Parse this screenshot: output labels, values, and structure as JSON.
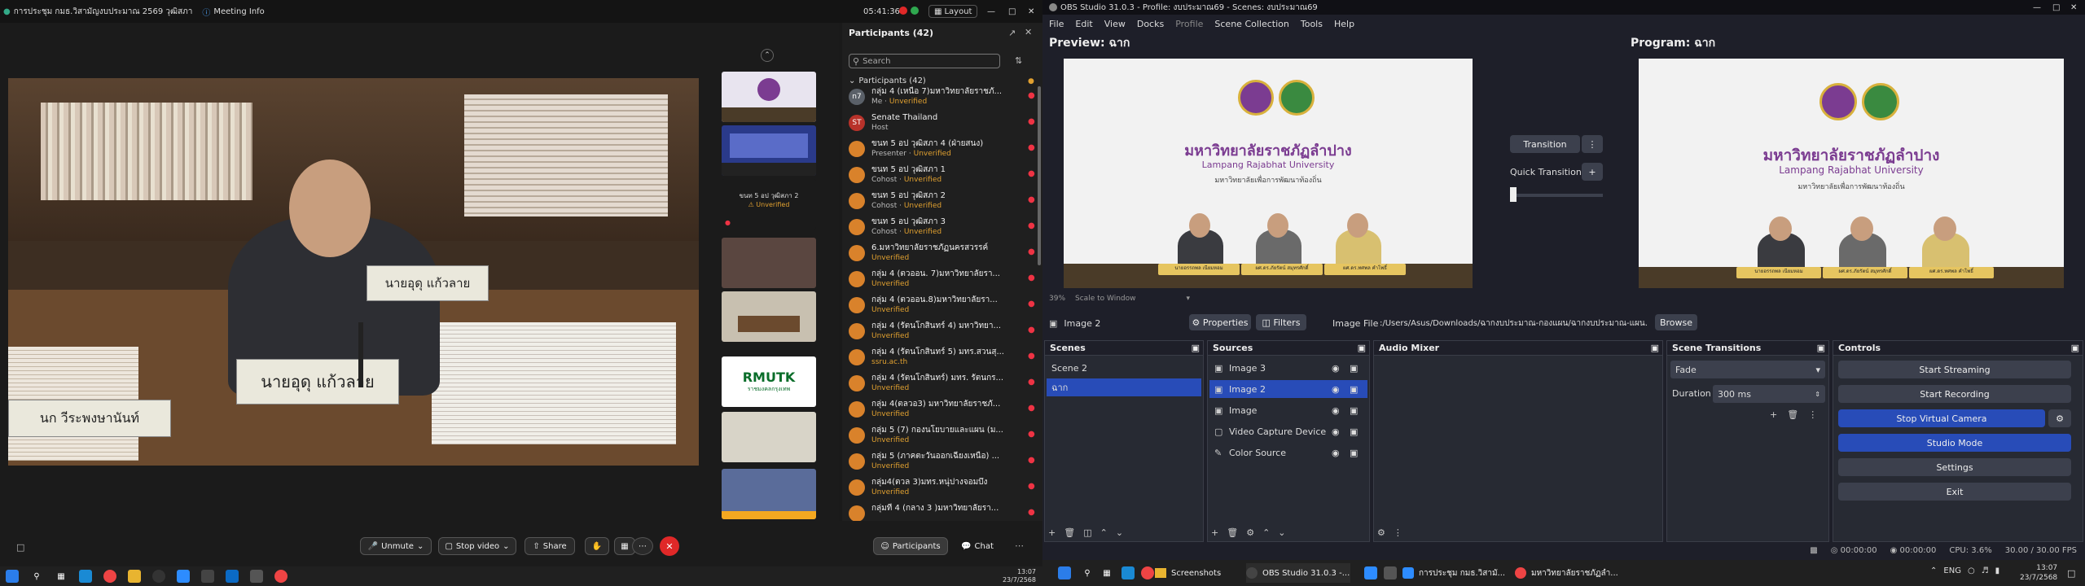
{
  "zoom": {
    "meeting_title": "การประชุม กมธ.วิสามัญงบประมาณ 2569 วุฒิสภา",
    "meeting_info": "Meeting Info",
    "timer": "05:41:36",
    "layout_label": "Layout",
    "nameplate_front": "นายอุดุ แก้วลาย",
    "nameplate_back": "นายอุดุ แก้วลาย",
    "nameplate_left": "นก วีระพงษานันท์",
    "thumb_label": "ขนท 5 อป วุฒิสภา 2",
    "thumb_status": "Unverified",
    "thumb_brand": "RMUTK",
    "thumb_brand_sub": "ราชมงคลกรุงเทพ",
    "toolbar": {
      "unmute": "Unmute",
      "stop_video": "Stop video",
      "share": "Share",
      "participants": "Participants",
      "chat": "Chat"
    },
    "panel_title": "Participants (42)",
    "search_placeholder": "Search",
    "group_title": "Participants (42)",
    "participants": [
      {
        "avatar": "n7",
        "name": "กลุ่ม 4 (เหนือ 7)มหาวิทยาลัยราชภั...",
        "role": "Me",
        "status": "Unverified"
      },
      {
        "avatar": "ST",
        "name": "Senate Thailand",
        "role": "Host",
        "status": ""
      },
      {
        "avatar": "",
        "name": "ขนท 5 อป วุฒิสภา 4 (ฝ่ายสนง)",
        "role": "Presenter",
        "status": "Unverified"
      },
      {
        "avatar": "",
        "name": "ขนท 5 อป วุฒิสภา 1",
        "role": "Cohost",
        "status": "Unverified"
      },
      {
        "avatar": "",
        "name": "ขนท 5 อป วุฒิสภา 2",
        "role": "Cohost",
        "status": "Unverified"
      },
      {
        "avatar": "",
        "name": "ขนท 5 อป วุฒิสภา 3",
        "role": "Cohost",
        "status": "Unverified"
      },
      {
        "avatar": "",
        "name": "6.มหาวิทยาลัยราชภัฏนครสวรรค์",
        "role": "",
        "status": "Unverified"
      },
      {
        "avatar": "",
        "name": "กลุ่ม 4 (ตวออน. 7)มหาวิทยาลัยรา...",
        "role": "",
        "status": "Unverified"
      },
      {
        "avatar": "",
        "name": "กลุ่ม 4 (ตวออน.8)มหาวิทยาลัยรา...",
        "role": "",
        "status": "Unverified"
      },
      {
        "avatar": "",
        "name": "กลุ่ม 4 (รัตนโกสินทร์ 4) มหาวิทยา...",
        "role": "",
        "status": "Unverified"
      },
      {
        "avatar": "",
        "name": "กลุ่ม 4 (รัตนโกสินทร์ 5) มทร.สวนสุ...",
        "role": "",
        "status": "ssru.ac.th"
      },
      {
        "avatar": "",
        "name": "กลุ่ม 4 (รัตนโกสินทร์) มทร. รัตนกร...",
        "role": "",
        "status": "Unverified"
      },
      {
        "avatar": "",
        "name": "กลุ่ม 4(ตลวอ3) มหาวิทยาลัยราชภั...",
        "role": "",
        "status": "Unverified"
      },
      {
        "avatar": "",
        "name": "กลุ่ม 5 (7) กองนโยบายและแผน (ม...",
        "role": "",
        "status": "Unverified"
      },
      {
        "avatar": "",
        "name": "กลุ่ม 5 (ภาคตะวันออกเฉียงเหนือ) ...",
        "role": "",
        "status": "Unverified"
      },
      {
        "avatar": "",
        "name": "กลุ่ม4(ตวล 3)มทร.หนุ่ปางจอมบึง",
        "role": "",
        "status": "Unverified"
      },
      {
        "avatar": "",
        "name": "กลุ่มที่ 4 (กลาง 3 )มหาวิทยาลัยรา...",
        "role": "",
        "status": ""
      }
    ],
    "tray_time": "13:07",
    "tray_date": "23/7/2568"
  },
  "obs": {
    "title": "OBS Studio 31.0.3 - Profile: งบประมาณ69 - Scenes: งบประมาณ69",
    "menu": [
      "File",
      "Edit",
      "View",
      "Docks",
      "Profile",
      "Scene Collection",
      "Tools",
      "Help"
    ],
    "preview_label": "Preview: ฉาก",
    "program_label": "Program: ฉาก",
    "uni_th": "มหาวิทยาลัยราชภัฏลำปาง",
    "uni_en": "Lampang Rajabhat University",
    "uni_motto": "มหาวิทยาลัยเพื่อการพัฒนาท้องถิ่น",
    "plates": [
      "นายอรรถพล เนียมหอม",
      "ผศ.ดร.ภัยรัตน์ สมุทรศักดิ์",
      "ผศ.ดร.ทศพล คำโพธิ์"
    ],
    "transition_button": "Transition",
    "quick_transitions": "Quick Transitions",
    "zoom_pct": "39%",
    "scale_mode": "Scale to Window",
    "selected_source": "Image 2",
    "properties": "Properties",
    "filters": "Filters",
    "image_file_label": "Image File",
    "image_file_path": ":/Users/Asus/Downloads/ฉากงบประมาณ-กองแผน/ฉากงบประมาณ-แผน.png",
    "browse": "Browse",
    "panels": {
      "scenes": "Scenes",
      "sources": "Sources",
      "mixer": "Audio Mixer",
      "transitions": "Scene Transitions",
      "controls": "Controls"
    },
    "scenes": [
      "Scene 2",
      "ฉาก"
    ],
    "sources": [
      {
        "name": "Image 3",
        "icon": "image-icon"
      },
      {
        "name": "Image 2",
        "icon": "image-icon"
      },
      {
        "name": "Image",
        "icon": "image-icon"
      },
      {
        "name": "Video Capture Device",
        "icon": "camera-icon"
      },
      {
        "name": "Color Source",
        "icon": "brush-icon"
      }
    ],
    "transition_type": "Fade",
    "duration_label": "Duration",
    "duration_value": "300 ms",
    "controls": [
      "Start Streaming",
      "Start Recording",
      "Stop Virtual Camera",
      "Studio Mode",
      "Settings",
      "Exit"
    ],
    "status": {
      "stream_time": "00:00:00",
      "rec_time": "00:00:00",
      "cpu": "CPU: 3.6%",
      "fps": "30.00 / 30.00 FPS"
    }
  },
  "taskbar2": {
    "apps": [
      {
        "label": "Screenshots"
      },
      {
        "label": "OBS Studio 31.0.3 -..."
      },
      {
        "label": "การประชุม กมธ.วิสามั..."
      },
      {
        "label": "มหาวิทยาลัยราชภัฏลำ..."
      }
    ],
    "lang": "ENG",
    "time": "13:07",
    "date": "23/7/2568"
  },
  "colors": {
    "obs_blue": "#284cb8",
    "zoom_red": "#e02828",
    "unverified": "#e0a030",
    "uni_purple": "#7b3c91"
  }
}
